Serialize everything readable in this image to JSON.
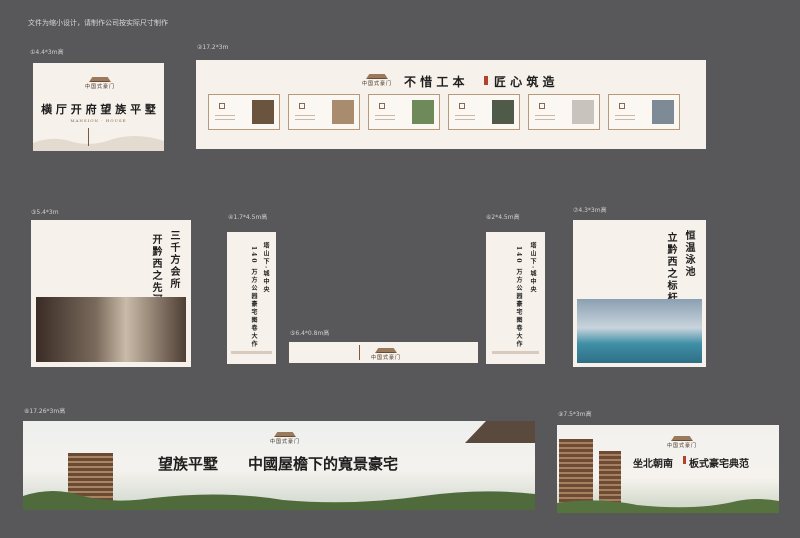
{
  "note": "文件为缩小设计，请制作公司按实际尺寸制作",
  "brand": {
    "name": "中国式豪门"
  },
  "panels": {
    "p1": {
      "label": "①4.4*3m高",
      "title": "横 厅 开 府   望 族 平 墅",
      "subtitle": "MANSION · HOUSE"
    },
    "p2": {
      "label": "②17.2*3m",
      "title_left": "不 惜 工 本",
      "title_right": "匠 心 筑 造"
    },
    "p3": {
      "label": "③5.4*3m",
      "text_right": "三千方会所",
      "text_left": "开黔西之先河"
    },
    "p4": {
      "label": "④1.7*4.5m高",
      "text_right": "塔山下·城中央",
      "text_left": "140 万方公园豪宅图卷大作"
    },
    "p5": {
      "label": "⑤6.4*0.8m高"
    },
    "p6": {
      "label": "⑥2*4.5m高",
      "text_right": "塔山下·城中央",
      "text_left": "140 万方公园豪宅图卷大作"
    },
    "p7": {
      "label": "⑦4.3*3m高",
      "text_right": "恒温泳池",
      "text_left": "立黔西之标杆"
    },
    "p8": {
      "label": "⑧17.26*3m高",
      "title_left": "望族平墅",
      "title_right": "中國屋檐下的寬景豪宅"
    },
    "p9": {
      "label": "⑨7.5*3m高",
      "title_left": "坐北朝南",
      "title_right": "板式豪宅典范"
    }
  },
  "colors": {
    "bg": "#58585a",
    "panel": "#f6f1ea",
    "accent": "#b2412e",
    "frame": "#b79a7d"
  }
}
